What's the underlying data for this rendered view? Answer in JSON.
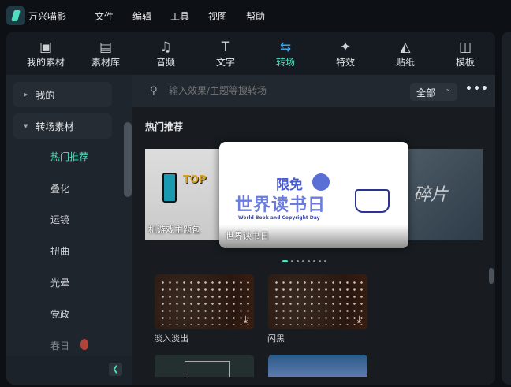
{
  "app": {
    "name": "万兴喵影"
  },
  "menu": [
    "文件",
    "编辑",
    "工具",
    "视图",
    "帮助"
  ],
  "toolbar": [
    {
      "label": "我的素材",
      "icon": "image-icon"
    },
    {
      "label": "素材库",
      "icon": "cloud-folder-icon"
    },
    {
      "label": "音频",
      "icon": "music-note-icon"
    },
    {
      "label": "文字",
      "icon": "text-icon"
    },
    {
      "label": "转场",
      "icon": "transition-icon"
    },
    {
      "label": "特效",
      "icon": "sparkle-star-icon"
    },
    {
      "label": "贴纸",
      "icon": "sticker-icon"
    },
    {
      "label": "模板",
      "icon": "template-icon"
    }
  ],
  "sidebar": {
    "groups": [
      "我的",
      "转场素材"
    ],
    "items": [
      "热门推荐",
      "叠化",
      "运镜",
      "扭曲",
      "光晕",
      "党政",
      "春日"
    ]
  },
  "search": {
    "placeholder": "输入效果/主题等搜转场",
    "filter": "全部",
    "more": "•••"
  },
  "section": {
    "title": "热门推荐"
  },
  "carousel": {
    "cards": [
      "机游戏主题包",
      "世界读书日",
      "碎片"
    ],
    "center_title": "限免",
    "center_heading": "世界读书日",
    "center_sub": "World Book and Copyright Day",
    "dots": 8,
    "active": 0
  },
  "grid": [
    "淡入淡出",
    "闪黑"
  ],
  "colors": {
    "accent": "#4fe0c0",
    "brand_blue": "#5a6fd6"
  }
}
